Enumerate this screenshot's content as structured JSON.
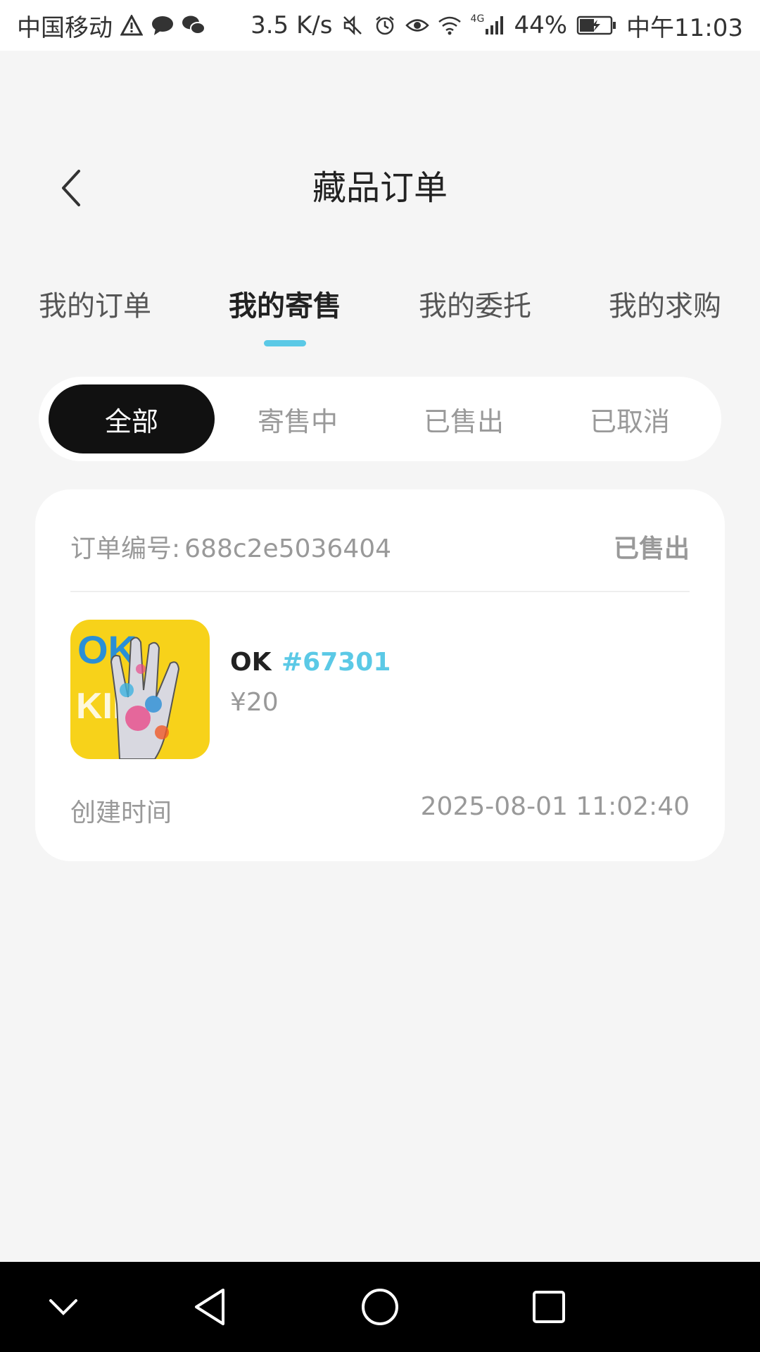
{
  "status_bar": {
    "carrier": "中国移动",
    "speed": "3.5 K/s",
    "network": "4G",
    "battery": "44%",
    "time": "中午11:03",
    "icons": [
      "warning-icon",
      "message-icon",
      "wechat-icon",
      "mute-icon",
      "alarm-icon",
      "eye-icon",
      "wifi-icon",
      "signal-icon",
      "battery-icon"
    ]
  },
  "header": {
    "title": "藏品订单",
    "back_icon": "chevron-left-icon"
  },
  "tabs": [
    {
      "label": "我的订单",
      "active": false
    },
    {
      "label": "我的寄售",
      "active": true
    },
    {
      "label": "我的委托",
      "active": false
    },
    {
      "label": "我的求购",
      "active": false
    }
  ],
  "filters": [
    {
      "label": "全部",
      "active": true
    },
    {
      "label": "寄售中",
      "active": false
    },
    {
      "label": "已售出",
      "active": false
    },
    {
      "label": "已取消",
      "active": false
    }
  ],
  "order": {
    "number_label": "订单编号:",
    "number": "688c2e5036404",
    "status": "已售出",
    "item_name": "OK",
    "item_id": "#67301",
    "price": "¥20",
    "created_label": "创建时间",
    "created_at": "2025-08-01 11:02:40",
    "thumb_text": "OK",
    "thumb_text_2": "KID"
  },
  "colors": {
    "accent": "#5bc9e6",
    "background": "#f5f5f5",
    "active_filter": "#111111",
    "thumb_bg": "#f7d21a"
  },
  "navbar": {
    "icons": [
      "chevron-down-icon",
      "back-triangle-icon",
      "home-circle-icon",
      "recents-square-icon"
    ]
  }
}
